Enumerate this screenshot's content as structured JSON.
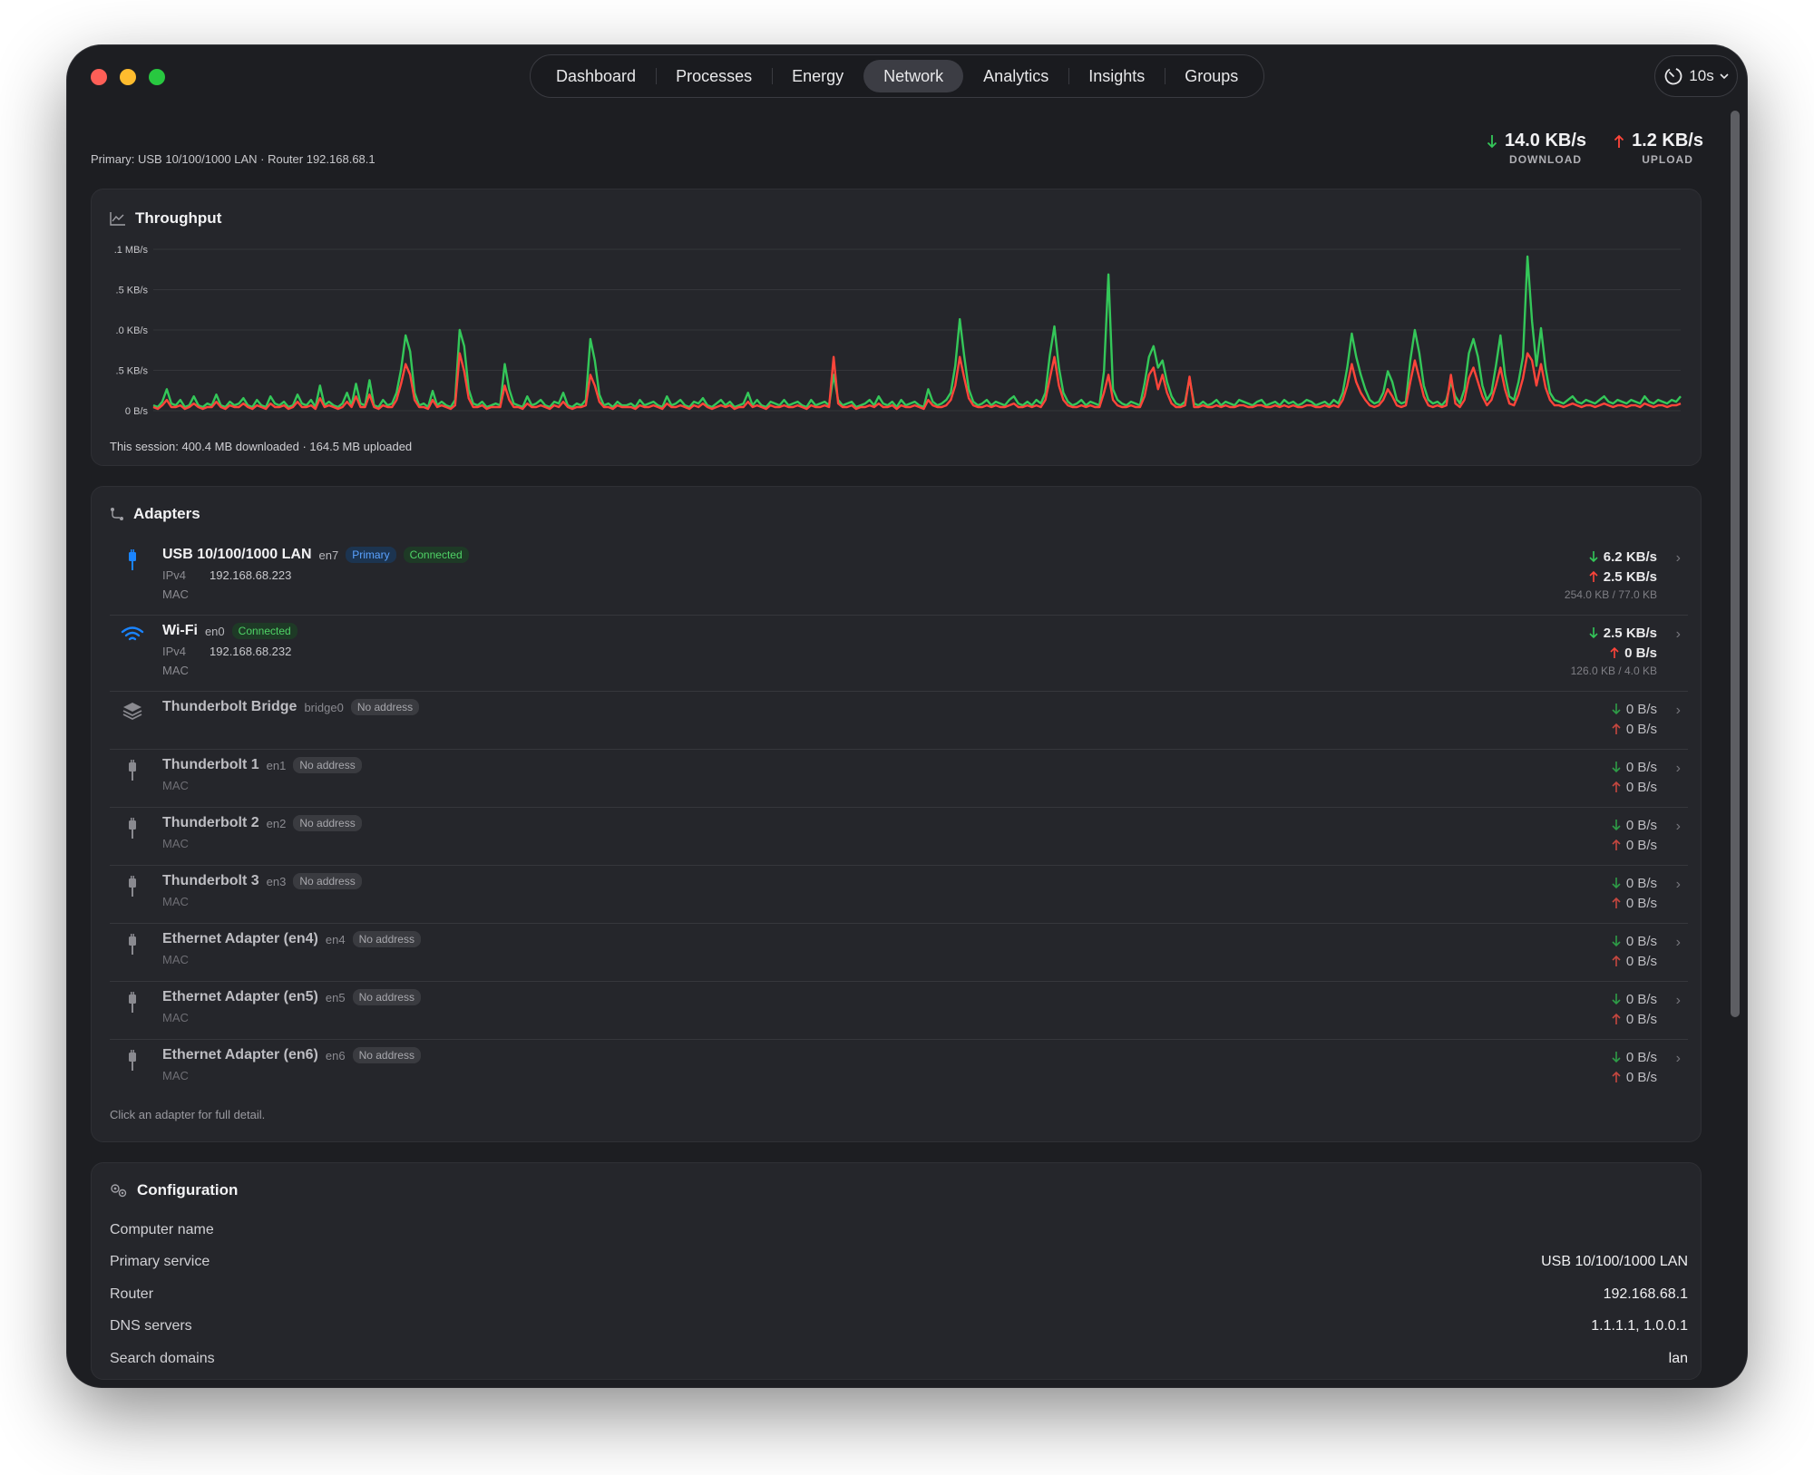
{
  "tabs": [
    {
      "label": "Dashboard"
    },
    {
      "label": "Processes"
    },
    {
      "label": "Energy"
    },
    {
      "label": "Network",
      "active": true
    },
    {
      "label": "Analytics"
    },
    {
      "label": "Insights"
    },
    {
      "label": "Groups"
    }
  ],
  "refresh": {
    "label": "10s",
    "icon": "timer-icon"
  },
  "primary_info": "Primary: USB 10/100/1000 LAN · Router 192.168.68.1",
  "rates": {
    "download": {
      "value": "14.0 KB/s",
      "caption": "DOWNLOAD",
      "color": "#34c759"
    },
    "upload": {
      "value": "1.2 KB/s",
      "caption": "UPLOAD",
      "color": "#ff453a"
    }
  },
  "throughput": {
    "title": "Throughput",
    "session": "This session: 400.4 MB downloaded · 164.5 MB uploaded"
  },
  "chart_data": {
    "type": "line",
    "y_tick_labels": [
      ".1 MB/s",
      ".5 KB/s",
      ".0 KB/s",
      ".5 KB/s",
      "0 B/s"
    ],
    "grid": true,
    "series": [
      {
        "color": "#34c759",
        "values": [
          0.3,
          0.2,
          0.5,
          1.2,
          0.4,
          0.3,
          0.6,
          0.2,
          0.3,
          0.8,
          0.3,
          0.2,
          0.4,
          0.3,
          0.9,
          0.3,
          0.2,
          0.5,
          0.3,
          0.4,
          0.7,
          0.3,
          0.2,
          0.6,
          0.3,
          0.2,
          0.8,
          0.4,
          0.3,
          0.5,
          0.2,
          0.3,
          0.9,
          0.4,
          0.3,
          0.6,
          0.2,
          1.4,
          0.3,
          0.5,
          0.3,
          0.2,
          0.4,
          1.0,
          0.3,
          1.5,
          0.4,
          0.3,
          1.7,
          0.3,
          0.2,
          0.6,
          0.3,
          0.4,
          1.0,
          2.3,
          4.2,
          3.3,
          1.0,
          0.3,
          0.4,
          0.2,
          1.1,
          0.3,
          0.5,
          0.3,
          0.2,
          0.6,
          4.5,
          3.6,
          1.2,
          0.4,
          0.3,
          0.5,
          0.2,
          0.3,
          0.4,
          0.3,
          2.6,
          1.2,
          0.4,
          0.3,
          0.2,
          0.8,
          0.3,
          0.4,
          0.6,
          0.3,
          0.2,
          0.5,
          0.4,
          1.0,
          0.3,
          0.2,
          0.4,
          0.3,
          0.6,
          4.0,
          2.8,
          0.9,
          0.3,
          0.4,
          0.2,
          0.5,
          0.3,
          0.3,
          0.4,
          0.2,
          0.6,
          0.3,
          0.4,
          0.5,
          0.3,
          0.2,
          0.8,
          0.3,
          0.4,
          0.6,
          0.3,
          0.2,
          0.5,
          0.4,
          0.7,
          0.3,
          0.2,
          0.4,
          0.6,
          0.3,
          0.5,
          0.2,
          0.3,
          0.4,
          1.0,
          0.3,
          0.6,
          0.3,
          0.2,
          0.5,
          0.4,
          0.3,
          0.6,
          0.3,
          0.4,
          0.5,
          0.3,
          0.2,
          0.6,
          0.3,
          0.4,
          0.5,
          0.3,
          2.0,
          0.6,
          0.3,
          0.4,
          0.5,
          0.2,
          0.3,
          0.4,
          0.6,
          0.3,
          0.8,
          0.4,
          0.3,
          0.5,
          0.2,
          0.6,
          0.3,
          0.4,
          0.5,
          0.3,
          0.2,
          1.2,
          0.5,
          0.3,
          0.4,
          0.6,
          1.0,
          2.5,
          5.1,
          3.0,
          1.2,
          0.5,
          0.3,
          0.4,
          0.6,
          0.3,
          0.5,
          0.4,
          0.3,
          0.6,
          0.8,
          0.4,
          0.3,
          0.5,
          0.3,
          0.6,
          0.4,
          1.0,
          3.1,
          4.7,
          2.4,
          1.0,
          0.5,
          0.3,
          0.4,
          0.6,
          0.3,
          0.5,
          0.4,
          0.3,
          2.2,
          7.6,
          1.2,
          0.6,
          0.4,
          0.3,
          0.5,
          0.4,
          0.3,
          1.5,
          3.0,
          3.6,
          2.4,
          2.8,
          1.6,
          0.8,
          0.4,
          0.3,
          0.5,
          1.8,
          0.4,
          0.3,
          0.5,
          0.3,
          0.4,
          0.6,
          0.3,
          0.5,
          0.4,
          0.3,
          0.6,
          0.5,
          0.4,
          0.3,
          0.5,
          0.6,
          0.3,
          0.4,
          0.5,
          0.3,
          0.6,
          0.4,
          0.5,
          0.3,
          0.4,
          0.6,
          0.5,
          0.3,
          0.4,
          0.5,
          0.3,
          0.6,
          0.4,
          1.0,
          2.4,
          4.3,
          3.0,
          2.0,
          1.2,
          0.6,
          0.4,
          0.5,
          1.0,
          2.2,
          1.6,
          0.6,
          0.4,
          0.5,
          2.8,
          4.5,
          3.2,
          1.4,
          0.6,
          0.4,
          0.5,
          0.3,
          0.6,
          1.6,
          0.8,
          0.4,
          1.2,
          3.2,
          4.0,
          3.0,
          1.4,
          0.6,
          1.0,
          2.5,
          4.2,
          2.0,
          0.8,
          0.6,
          1.6,
          3.0,
          8.6,
          5.0,
          2.5,
          4.6,
          2.4,
          1.0,
          0.6,
          0.5,
          0.4,
          0.6,
          0.8,
          0.5,
          0.4,
          0.6,
          0.5,
          0.4,
          0.6,
          0.8,
          0.5,
          0.4,
          0.6,
          0.5,
          0.4,
          0.6,
          0.5,
          0.4,
          0.8,
          0.5,
          0.4,
          0.6,
          0.5,
          0.4,
          0.6,
          0.5,
          0.8
        ]
      },
      {
        "color": "#ff453a",
        "values": [
          0.2,
          0.1,
          0.3,
          0.6,
          0.2,
          0.2,
          0.3,
          0.1,
          0.2,
          0.4,
          0.2,
          0.1,
          0.2,
          0.2,
          0.5,
          0.2,
          0.1,
          0.3,
          0.2,
          0.2,
          0.4,
          0.2,
          0.1,
          0.3,
          0.2,
          0.1,
          0.4,
          0.2,
          0.2,
          0.3,
          0.1,
          0.2,
          0.5,
          0.2,
          0.2,
          0.3,
          0.1,
          0.7,
          0.2,
          0.3,
          0.2,
          0.1,
          0.2,
          0.5,
          0.2,
          0.8,
          0.2,
          0.2,
          0.9,
          0.2,
          0.1,
          0.3,
          0.2,
          0.2,
          0.6,
          1.5,
          2.6,
          2.0,
          0.6,
          0.2,
          0.2,
          0.1,
          0.6,
          0.2,
          0.3,
          0.2,
          0.1,
          0.3,
          3.2,
          2.2,
          0.7,
          0.2,
          0.2,
          0.3,
          0.1,
          0.2,
          0.2,
          0.2,
          1.4,
          0.6,
          0.2,
          0.2,
          0.1,
          0.4,
          0.2,
          0.2,
          0.3,
          0.2,
          0.1,
          0.3,
          0.2,
          0.5,
          0.2,
          0.1,
          0.2,
          0.2,
          0.3,
          2.0,
          1.4,
          0.5,
          0.2,
          0.2,
          0.1,
          0.3,
          0.2,
          0.2,
          0.2,
          0.1,
          0.3,
          0.2,
          0.2,
          0.3,
          0.2,
          0.1,
          0.4,
          0.2,
          0.2,
          0.3,
          0.2,
          0.1,
          0.3,
          0.2,
          0.4,
          0.2,
          0.1,
          0.2,
          0.3,
          0.2,
          0.3,
          0.1,
          0.2,
          0.2,
          0.5,
          0.2,
          0.3,
          0.2,
          0.1,
          0.3,
          0.2,
          0.2,
          0.3,
          0.2,
          0.2,
          0.3,
          0.2,
          0.1,
          0.3,
          0.2,
          0.2,
          0.3,
          0.2,
          3.0,
          0.4,
          0.2,
          0.2,
          0.3,
          0.1,
          0.2,
          0.2,
          0.3,
          0.2,
          0.4,
          0.2,
          0.2,
          0.3,
          0.1,
          0.3,
          0.2,
          0.2,
          0.3,
          0.2,
          0.1,
          0.6,
          0.3,
          0.2,
          0.2,
          0.3,
          0.6,
          1.4,
          3.0,
          1.8,
          0.7,
          0.3,
          0.2,
          0.2,
          0.3,
          0.2,
          0.3,
          0.2,
          0.2,
          0.3,
          0.4,
          0.2,
          0.2,
          0.3,
          0.2,
          0.3,
          0.2,
          0.6,
          1.8,
          3.0,
          1.4,
          0.6,
          0.3,
          0.2,
          0.2,
          0.3,
          0.2,
          0.3,
          0.2,
          0.2,
          1.0,
          2.0,
          0.6,
          0.3,
          0.2,
          0.2,
          0.3,
          0.2,
          0.2,
          0.8,
          2.0,
          2.4,
          1.2,
          2.0,
          1.0,
          0.4,
          0.2,
          0.2,
          0.3,
          1.9,
          0.2,
          0.2,
          0.3,
          0.2,
          0.2,
          0.3,
          0.2,
          0.3,
          0.2,
          0.2,
          0.3,
          0.3,
          0.2,
          0.2,
          0.3,
          0.3,
          0.2,
          0.2,
          0.3,
          0.2,
          0.3,
          0.2,
          0.3,
          0.2,
          0.2,
          0.3,
          0.3,
          0.2,
          0.2,
          0.3,
          0.2,
          0.3,
          0.2,
          0.6,
          1.4,
          2.6,
          1.6,
          1.0,
          0.6,
          0.3,
          0.2,
          0.3,
          0.6,
          1.2,
          0.8,
          0.3,
          0.2,
          0.3,
          1.6,
          2.8,
          1.8,
          0.8,
          0.3,
          0.2,
          0.3,
          0.2,
          0.3,
          2.0,
          0.4,
          0.2,
          0.6,
          1.8,
          2.4,
          1.6,
          0.8,
          0.3,
          0.6,
          1.4,
          2.4,
          1.2,
          0.4,
          0.3,
          0.9,
          1.8,
          3.2,
          2.8,
          1.4,
          2.6,
          1.3,
          0.6,
          0.3,
          0.3,
          0.2,
          0.3,
          0.4,
          0.3,
          0.2,
          0.3,
          0.3,
          0.2,
          0.3,
          0.4,
          0.3,
          0.2,
          0.3,
          0.3,
          0.2,
          0.3,
          0.3,
          0.2,
          0.4,
          0.3,
          0.2,
          0.3,
          0.3,
          0.2,
          0.3,
          0.3,
          0.4
        ]
      }
    ]
  },
  "adapters": {
    "title": "Adapters",
    "footer": "Click an adapter for full detail.",
    "items": [
      {
        "icon": "ethernet-plug-icon",
        "name": "USB 10/100/1000 LAN",
        "dev": "en7",
        "badges": [
          {
            "label": "Primary",
            "kind": "primary"
          },
          {
            "label": "Connected",
            "kind": "conn"
          }
        ],
        "ipv4_label": "IPv4",
        "ipv4": "192.168.68.223",
        "mac_label": "MAC",
        "down": "6.2 KB/s",
        "up": "2.5 KB/s",
        "total": "254.0 KB / 77.0 KB",
        "active": true
      },
      {
        "icon": "wifi-icon",
        "name": "Wi-Fi",
        "dev": "en0",
        "badges": [
          {
            "label": "Connected",
            "kind": "conn"
          }
        ],
        "ipv4_label": "IPv4",
        "ipv4": "192.168.68.232",
        "mac_label": "MAC",
        "down": "2.5 KB/s",
        "up": "0 B/s",
        "total": "126.0 KB / 4.0 KB",
        "active": true
      },
      {
        "icon": "bridge-layers-icon",
        "name": "Thunderbolt Bridge",
        "dev": "bridge0",
        "badges": [
          {
            "label": "No address",
            "kind": "none"
          }
        ],
        "down": "0 B/s",
        "up": "0 B/s",
        "active": false
      },
      {
        "icon": "ethernet-plug-icon",
        "name": "Thunderbolt 1",
        "dev": "en1",
        "badges": [
          {
            "label": "No address",
            "kind": "none"
          }
        ],
        "mac_label": "MAC",
        "down": "0 B/s",
        "up": "0 B/s",
        "active": false
      },
      {
        "icon": "ethernet-plug-icon",
        "name": "Thunderbolt 2",
        "dev": "en2",
        "badges": [
          {
            "label": "No address",
            "kind": "none"
          }
        ],
        "mac_label": "MAC",
        "down": "0 B/s",
        "up": "0 B/s",
        "active": false
      },
      {
        "icon": "ethernet-plug-icon",
        "name": "Thunderbolt 3",
        "dev": "en3",
        "badges": [
          {
            "label": "No address",
            "kind": "none"
          }
        ],
        "mac_label": "MAC",
        "down": "0 B/s",
        "up": "0 B/s",
        "active": false
      },
      {
        "icon": "ethernet-plug-icon",
        "name": "Ethernet Adapter (en4)",
        "dev": "en4",
        "badges": [
          {
            "label": "No address",
            "kind": "none"
          }
        ],
        "mac_label": "MAC",
        "down": "0 B/s",
        "up": "0 B/s",
        "active": false
      },
      {
        "icon": "ethernet-plug-icon",
        "name": "Ethernet Adapter (en5)",
        "dev": "en5",
        "badges": [
          {
            "label": "No address",
            "kind": "none"
          }
        ],
        "mac_label": "MAC",
        "down": "0 B/s",
        "up": "0 B/s",
        "active": false
      },
      {
        "icon": "ethernet-plug-icon",
        "name": "Ethernet Adapter (en6)",
        "dev": "en6",
        "badges": [
          {
            "label": "No address",
            "kind": "none"
          }
        ],
        "mac_label": "MAC",
        "down": "0 B/s",
        "up": "0 B/s",
        "active": false
      }
    ]
  },
  "configuration": {
    "title": "Configuration",
    "rows": [
      {
        "key": "Computer name",
        "value": ""
      },
      {
        "key": "Primary service",
        "value": "USB 10/100/1000 LAN"
      },
      {
        "key": "Router",
        "value": "192.168.68.1"
      },
      {
        "key": "DNS servers",
        "value": "1.1.1.1, 1.0.0.1"
      },
      {
        "key": "Search domains",
        "value": "lan"
      }
    ]
  }
}
